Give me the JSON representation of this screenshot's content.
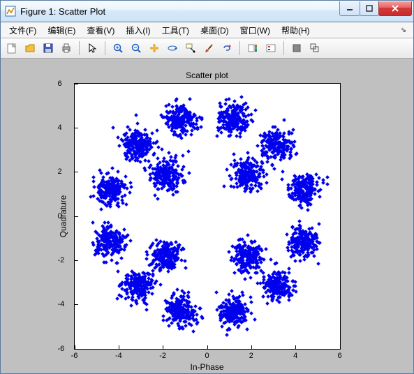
{
  "window": {
    "title": "Figure 1: Scatter Plot"
  },
  "menubar": {
    "items": [
      {
        "label": "文件(F)"
      },
      {
        "label": "编辑(E)"
      },
      {
        "label": "查看(V)"
      },
      {
        "label": "插入(I)"
      },
      {
        "label": "工具(T)"
      },
      {
        "label": "桌面(D)"
      },
      {
        "label": "窗口(W)"
      },
      {
        "label": "帮助(H)"
      }
    ]
  },
  "toolbar": {
    "groups": [
      [
        "new-figure-icon",
        "open-icon",
        "save-icon",
        "print-icon"
      ],
      [
        "pointer-icon"
      ],
      [
        "zoom-in-icon",
        "zoom-out-icon",
        "pan-icon",
        "rotate3d-icon",
        "data-cursor-icon",
        "brush-icon",
        "link-icon"
      ],
      [
        "colorbar-icon",
        "legend-icon"
      ],
      [
        "hide-tools-icon",
        "show-tools-icon"
      ]
    ]
  },
  "chart_data": {
    "type": "scatter",
    "title": "Scatter plot",
    "xlabel": "In-Phase",
    "ylabel": "Quadrature",
    "xlim": [
      -6,
      6
    ],
    "ylim": [
      -6,
      6
    ],
    "xticks": [
      -6,
      -4,
      -2,
      0,
      2,
      4,
      6
    ],
    "yticks": [
      -6,
      -4,
      -2,
      0,
      2,
      4,
      6
    ],
    "marker": "diamond",
    "color": "#0000ee",
    "clusters": {
      "description": "16-APSK constellation with AWGN: 4 inner points at radius≈2.6 (phases 45,135,225,315°) and 12 outer points at radius≈4.5 (phases every 30° starting at 15°), ~200 noisy samples per symbol (σ≈0.35)",
      "inner_radius": 2.6,
      "outer_radius": 4.5,
      "inner_phases_deg": [
        45,
        135,
        225,
        315
      ],
      "outer_phases_deg": [
        15,
        45,
        75,
        105,
        135,
        165,
        195,
        225,
        255,
        285,
        315,
        345
      ],
      "points_per_symbol": 200,
      "noise_sigma": 0.35,
      "centers": [
        {
          "x": 1.84,
          "y": 1.84
        },
        {
          "x": -1.84,
          "y": 1.84
        },
        {
          "x": -1.84,
          "y": -1.84
        },
        {
          "x": 1.84,
          "y": -1.84
        },
        {
          "x": 4.35,
          "y": 1.16
        },
        {
          "x": 3.18,
          "y": 3.18
        },
        {
          "x": 1.16,
          "y": 4.35
        },
        {
          "x": -1.16,
          "y": 4.35
        },
        {
          "x": -3.18,
          "y": 3.18
        },
        {
          "x": -4.35,
          "y": 1.16
        },
        {
          "x": -4.35,
          "y": -1.16
        },
        {
          "x": -3.18,
          "y": -3.18
        },
        {
          "x": -1.16,
          "y": -4.35
        },
        {
          "x": 1.16,
          "y": -4.35
        },
        {
          "x": 3.18,
          "y": -3.18
        },
        {
          "x": 4.35,
          "y": -1.16
        }
      ]
    }
  }
}
